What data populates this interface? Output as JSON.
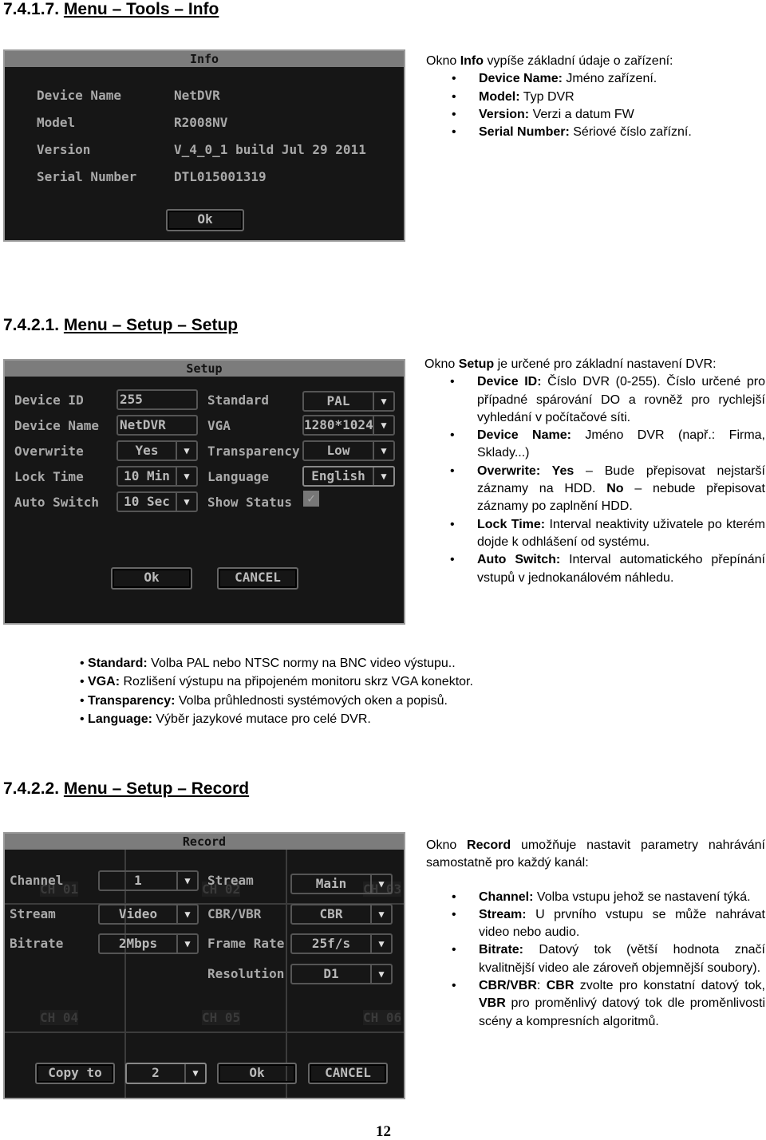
{
  "section1": {
    "heading_num": "7.4.1.7.",
    "heading_title": "Menu – Tools – Info",
    "dialog": {
      "title": "Info",
      "rows": [
        {
          "label": "Device Name",
          "value": "NetDVR"
        },
        {
          "label": "Model",
          "value": "R2008NV"
        },
        {
          "label": "Version",
          "value": "V_4_0_1 build Jul 29 2011"
        },
        {
          "label": "Serial Number",
          "value": "DTL015001319"
        }
      ],
      "ok": "Ok"
    },
    "intro": {
      "pre": "Okno ",
      "bold": "Info",
      "post": " vypíše základní údaje o zařízení:"
    },
    "bullets": [
      {
        "label": "Device Name:",
        "text": " Jméno zařízení."
      },
      {
        "label": "Model:",
        "text": " Typ DVR"
      },
      {
        "label": "Version:",
        "text": " Verzi a datum FW"
      },
      {
        "label": "Serial Number:",
        "text": " Sériové číslo zařízní."
      }
    ]
  },
  "section2": {
    "heading_num": "7.4.2.1.",
    "heading_title": "Menu – Setup – Setup",
    "dialog": {
      "title": "Setup",
      "device_id_label": "Device ID",
      "device_id": "255",
      "device_name_label": "Device Name",
      "device_name": "NetDVR",
      "overwrite_label": "Overwrite",
      "overwrite": "Yes",
      "lock_time_label": "Lock Time",
      "lock_time": "10 Min",
      "auto_switch_label": "Auto Switch",
      "auto_switch": "10 Sec",
      "standard_label": "Standard",
      "standard": "PAL",
      "vga_label": "VGA",
      "vga": "1280*1024",
      "transparency_label": "Transparency",
      "transparency": "Low",
      "language_label": "Language",
      "language": "English",
      "show_status_label": "Show Status",
      "show_status_checked": true,
      "ok": "Ok",
      "cancel": "CANCEL"
    },
    "intro": {
      "pre": "Okno ",
      "bold": "Setup",
      "post": " je určené pro základní nastavení DVR:"
    },
    "bullets": [
      {
        "label": "Device ID:",
        "text": " Číslo DVR (0-255). Číslo určené pro případné spárování DO a rovněž pro rychlejší vyhledání v počítačové síti."
      },
      {
        "label": "Device Name:",
        "text": " Jméno DVR (např.: Firma, Sklady...)"
      },
      {
        "label": "Overwrite: Yes",
        "text": " – Bude přepisovat nejstarší záznamy na HDD. ",
        "label2": "No",
        "text2": " – nebude přepisovat záznamy po zaplnění HDD."
      },
      {
        "label": "Lock Time:",
        "text": " Interval neaktivity uživatele po kterém dojde k odhlášení od systému."
      },
      {
        "label": "Auto Switch:",
        "text": " Interval automatického přepínání vstupů v jednokanálovém náhledu."
      }
    ],
    "bullets_bottom": [
      {
        "label": "Standard:",
        "text": " Volba PAL nebo NTSC normy na BNC video výstupu.."
      },
      {
        "label": "VGA:",
        "text": " Rozlišení výstupu na připojeném monitoru skrz VGA konektor."
      },
      {
        "label": "Transparency:",
        "text": " Volba průhlednosti systémových oken a popisů."
      },
      {
        "label": "Language:",
        "text": " Výběr jazykové mutace pro celé DVR."
      }
    ]
  },
  "section3": {
    "heading_num": "7.4.2.2.",
    "heading_title": "Menu – Setup – Record",
    "dialog": {
      "title": "Record",
      "channel_label": "Channel",
      "channel": "1",
      "stream_label": "Stream",
      "stream": "Video",
      "bitrate_label": "Bitrate",
      "bitrate": "2Mbps",
      "stream2_label": "Stream",
      "stream2": "Main",
      "cbr_label": "CBR/VBR",
      "cbr": "CBR",
      "frame_rate_label": "Frame Rate",
      "frame_rate": "25f/s",
      "resolution_label": "Resolution",
      "resolution": "D1",
      "channels_bg": [
        "CH 01",
        "CH 02",
        "CH 03",
        "CH 04",
        "CH 05",
        "CH 06"
      ],
      "copy_to": "Copy to",
      "copy_target": "2",
      "ok": "Ok",
      "cancel": "CANCEL"
    },
    "intro": {
      "pre": "Okno ",
      "bold": "Record",
      "post": " umožňuje nastavit parametry nahrávání samostatně pro každý kanál:"
    },
    "bullets": [
      {
        "label": "Channel:",
        "text": " Volba vstupu jehož se nastavení týká."
      },
      {
        "label": "Stream:",
        "text": " U prvního vstupu se může nahrávat video nebo audio."
      },
      {
        "label": "Bitrate:",
        "text": " Datový tok (větší hodnota značí kvalitnější video ale zároveň objemnější soubory)."
      },
      {
        "label": "CBR/VBR",
        "text": ": ",
        "label2": "CBR",
        "text2": " zvolte pro konstatní datový tok, ",
        "label3": "VBR",
        "text3": " pro proměnlivý datový tok dle proměnlivosti scény a kompresních algoritmů."
      }
    ]
  },
  "page_number": "12"
}
